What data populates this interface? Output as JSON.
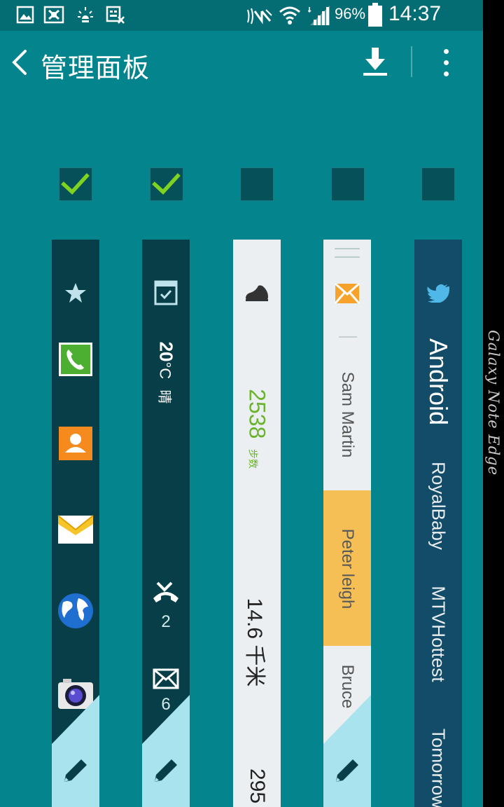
{
  "status_bar": {
    "battery_percent": "96%",
    "time": "14:37",
    "icons": [
      "gallery-icon",
      "screenshot-icon",
      "brightness-icon",
      "keyboard-off-icon",
      "nfc-icon",
      "mute-icon",
      "wifi-icon",
      "signal-icon",
      "battery-icon"
    ]
  },
  "app_bar": {
    "title": "管理面板",
    "actions": [
      "download-icon",
      "overflow-menu-icon"
    ]
  },
  "panels": [
    {
      "id": "favorites",
      "checked": true,
      "items": [
        "star-icon",
        "phone-icon",
        "contacts-icon",
        "email-icon",
        "globe-icon",
        "camera-icon"
      ],
      "edit": "pencil-icon"
    },
    {
      "id": "briefing",
      "checked": true,
      "temperature": "20",
      "temp_unit": "°C",
      "weather": "晴",
      "missed_calls": "2",
      "messages": "6",
      "edit": "pencil-icon"
    },
    {
      "id": "s-health",
      "checked": false,
      "steps": "2538",
      "steps_label": "步数",
      "distance": "14.6 千米",
      "calories": "295"
    },
    {
      "id": "contacts",
      "checked": false,
      "names": [
        "Sam Martin",
        "Peter leigh",
        "Bruce"
      ],
      "edit": "pencil-icon"
    },
    {
      "id": "twitter-trends",
      "checked": false,
      "trends": [
        "Android",
        "RoyalBaby",
        "MTVHottest",
        "Tomorrow"
      ]
    }
  ],
  "edge_brand": "Galaxy Note Edge",
  "colors": {
    "background": "#04858e",
    "status_bar": "#046c73",
    "check_green": "#7ed321",
    "health_green": "#6ab42d",
    "highlight_orange": "#f5bf55",
    "edit_blue": "#a8e3ee"
  }
}
